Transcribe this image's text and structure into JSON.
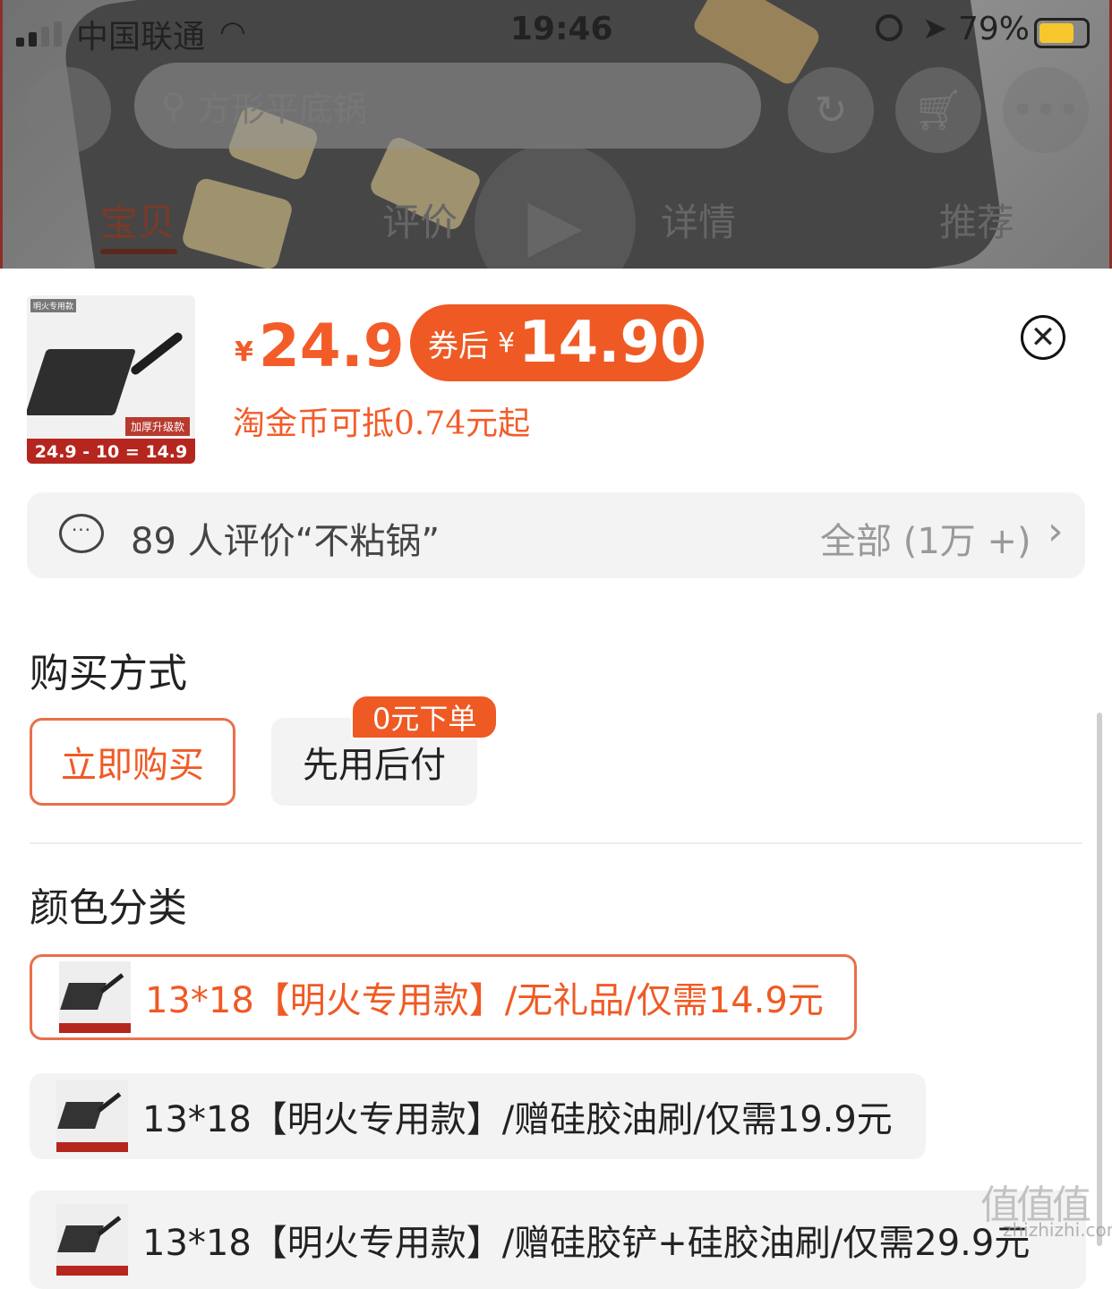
{
  "status_bar": {
    "carrier": "中国联通",
    "time": "19:46",
    "battery": "79%"
  },
  "header": {
    "search_placeholder": "方形平底锅",
    "tabs": [
      {
        "label": "宝贝",
        "active": true
      },
      {
        "label": "评价",
        "active": false
      },
      {
        "label": "详情",
        "active": false
      },
      {
        "label": "推荐",
        "active": false
      }
    ]
  },
  "product": {
    "thumb_tag": "明火专用款",
    "thumb_upgrade": "加厚升级款",
    "thumb_band": "24.9 - 10 = 14.9",
    "currency": "¥",
    "price": "24.9",
    "coupon_label": "券后",
    "coupon_price": "14.90",
    "coin_text": "淘金币可抵0.74元起"
  },
  "review": {
    "text": "89 人评价“不粘锅”",
    "all": "全部 (1万 +)"
  },
  "purchase": {
    "title": "购买方式",
    "buy_now": "立即购买",
    "pay_later": "先用后付",
    "pay_later_badge": "0元下单"
  },
  "color": {
    "title": "颜色分类",
    "options": [
      {
        "label": "13*18【明火专用款】/无礼品/仅需14.9元",
        "selected": true
      },
      {
        "label": "13*18【明火专用款】/赠硅胶油刷/仅需19.9元",
        "selected": false
      },
      {
        "label": "13*18【明火专用款】/赠硅胶铲+硅胶油刷/仅需29.9元",
        "selected": false
      }
    ]
  },
  "watermark": {
    "text": "值值值",
    "sub": "zhizhizhi.com"
  },
  "colors": {
    "accent": "#ef5a24",
    "price": "#f35c29",
    "option_bg": "#f3f3f3"
  }
}
